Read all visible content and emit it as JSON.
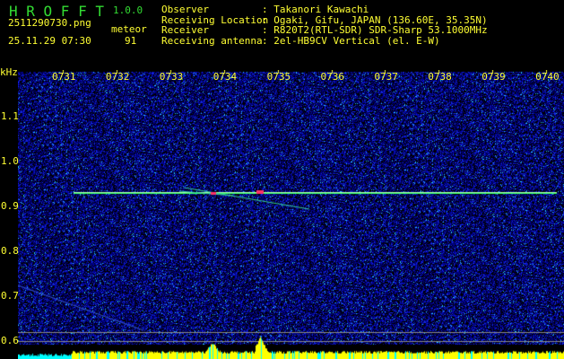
{
  "app": {
    "name": "H R O F F T",
    "version": "1.0.0"
  },
  "file": {
    "name": "2511290730.png",
    "datetime": "25.11.29 07:30"
  },
  "meteor": {
    "label": "meteor",
    "count": "91"
  },
  "info": [
    {
      "label": "Observer",
      "value": ": Takanori Kawachi"
    },
    {
      "label": "Receiving Location",
      "value": ": Ogaki, Gifu, JAPAN (136.60E, 35.35N)"
    },
    {
      "label": "Receiver",
      "value": ": R820T2(RTL-SDR) SDR-Sharp 53.1000MHz"
    },
    {
      "label": "Receiving antenna",
      "value": ": 2el-HB9CV Vertical (el. E-W)"
    }
  ],
  "axis": {
    "unit": "kHz",
    "time_labels": [
      "0731",
      "0732",
      "0733",
      "0734",
      "0735",
      "0736",
      "0737",
      "0738",
      "0739",
      "0740"
    ],
    "freq_labels": [
      "1.1",
      "1.0",
      "0.9",
      "0.8",
      "0.7",
      "0.6"
    ]
  },
  "colors": {
    "text": "#ffff33",
    "title": "#33dd33",
    "background_noise": "#0000aa",
    "carrier": "#33ff66",
    "level_bars": "#ffff00",
    "level_low": "#00ffff"
  }
}
